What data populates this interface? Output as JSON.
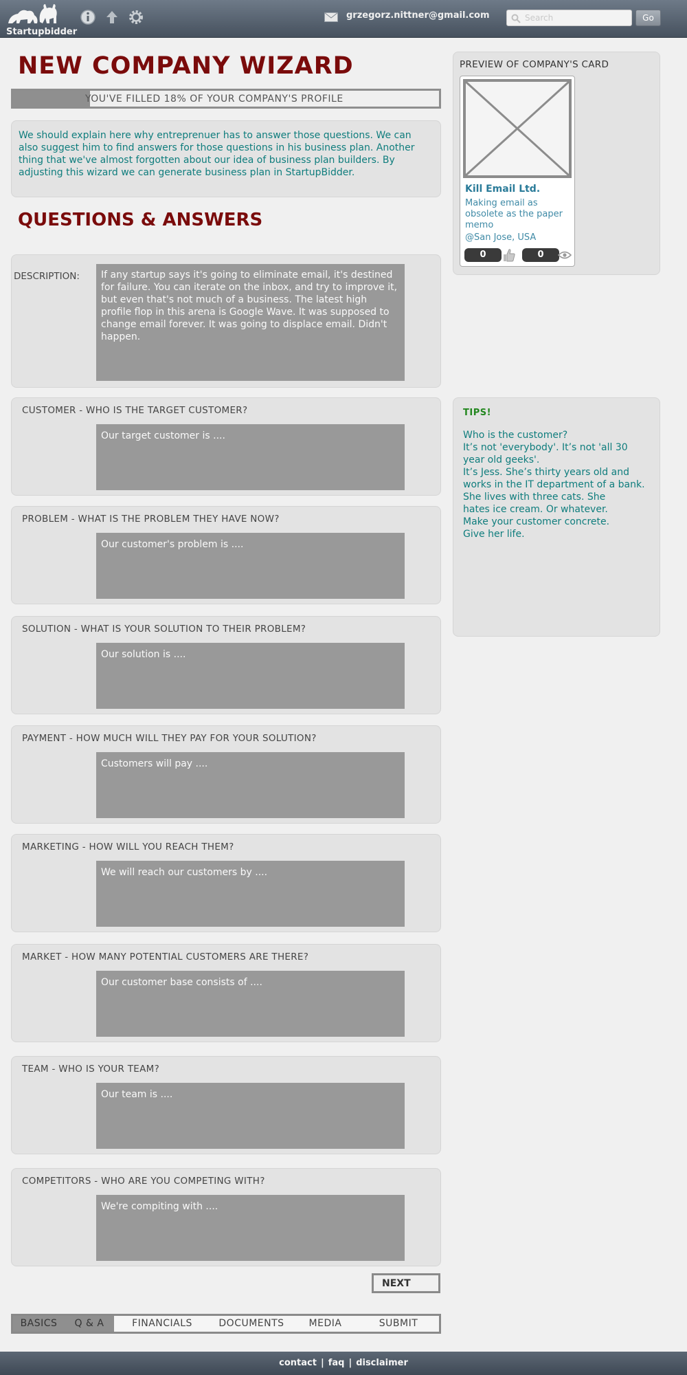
{
  "header": {
    "logo_text": "Startupbidder",
    "user_email": "grzegorz.nittner@gmail.com",
    "search_placeholder": "Search",
    "go_label": "Go"
  },
  "wizard": {
    "title": "NEW COMPANY WIZARD",
    "progress_percent": 18,
    "progress_text": "YOU'VE FILLED 18% OF YOUR COMPANY'S PROFILE",
    "intro": "We should explain here why entreprenuer has to answer those questions. We can also suggest him to find answers for those questions in his business plan. Another thing that we've almost forgotten about our idea of business plan builders. By adjusting this wizard we can generate business plan in StartupBidder.",
    "section_title": "QUESTIONS & ANSWERS",
    "description_label": "DESCRIPTION:",
    "description_value": "If any startup says it's going to eliminate email, it's destined for failure. You can iterate on the inbox, and try to improve it, but even that's not much of a business. The latest high profile flop in this arena is Google Wave. It was supposed to change email forever. It was going to displace email. Didn't happen.",
    "questions": [
      {
        "label": "CUSTOMER - WHO IS THE TARGET CUSTOMER?",
        "value": "Our target customer is ...."
      },
      {
        "label": "PROBLEM - WHAT IS THE PROBLEM THEY HAVE NOW?",
        "value": "Our customer's problem is ...."
      },
      {
        "label": "SOLUTION - WHAT IS YOUR SOLUTION TO THEIR PROBLEM?",
        "value": "Our solution is ...."
      },
      {
        "label": "PAYMENT - HOW MUCH WILL THEY PAY FOR YOUR SOLUTION?",
        "value": "Customers will pay ...."
      },
      {
        "label": "MARKETING - HOW WILL YOU REACH THEM?",
        "value": "We will reach our customers by ...."
      },
      {
        "label": "MARKET - HOW MANY POTENTIAL CUSTOMERS ARE THERE?",
        "value": "Our customer base consists of ...."
      },
      {
        "label": "TEAM - WHO IS YOUR TEAM?",
        "value": "Our team is ...."
      },
      {
        "label": "COMPETITORS - WHO ARE YOU COMPETING WITH?",
        "value": "We're compiting with ...."
      }
    ],
    "next_label": "NEXT",
    "steps": [
      "BASICS",
      "Q & A",
      "FINANCIALS",
      "DOCUMENTS",
      "MEDIA",
      "SUBMIT"
    ]
  },
  "preview": {
    "title": "PREVIEW OF COMPANY'S CARD",
    "company_name": "Kill Email Ltd.",
    "tagline": "Making email as obsolete as the paper memo",
    "location": "@San Jose, USA",
    "likes": "0",
    "views": "0"
  },
  "tips": {
    "title": "TIPS!",
    "body_lines": [
      "Who is the customer?",
      "It’s not 'everybody'. It’s not 'all 30 year old geeks'.",
      "It’s Jess. She’s thirty years old and works in the IT department of a bank. She lives with three cats. She",
      "hates ice cream. Or whatever.",
      "Make your customer concrete.",
      "Give her life."
    ]
  },
  "footer": {
    "links": [
      "contact",
      "faq",
      "disclaimer"
    ],
    "separator": "|"
  },
  "colors": {
    "title_red": "#7a0b0b",
    "teal_text": "#0f7d7d",
    "tips_green": "#23871f",
    "card_blue": "#2a7b99"
  }
}
